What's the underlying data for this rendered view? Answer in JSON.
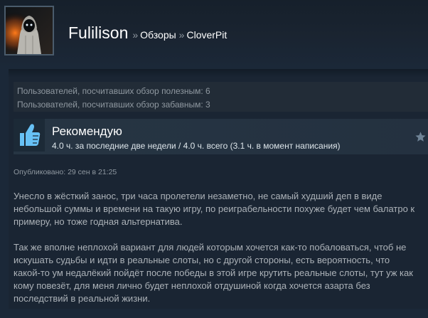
{
  "header": {
    "persona_name": "Fulilison",
    "breadcrumb_sep": "»",
    "breadcrumb_reviews": "Обзоры",
    "breadcrumb_game": "CloverPit"
  },
  "ratings": {
    "helpful": "Пользователей, посчитавших обзор полезным: 6",
    "funny": "Пользователей, посчитавших обзор забавным: 3"
  },
  "review": {
    "verdict": "Рекомендую",
    "hours": "4.0 ч. за последние две недели / 4.0 ч. всего (3.1 ч. в момент написания)",
    "posted": "Опубликовано: 29 сен в 21:25",
    "paragraphs": [
      "Унесло в жёсткий занос, три часа пролетели незаметно, не самый худший деп в виде небольшой суммы и времени на такую игру, по реиграбельности похуже будет чем балатро к примеру, но тоже годная альтернатива.",
      "Так же вполне неплохой вариант для людей которым хочется как-то побаловаться, чтоб не искушать судьбы и идти в реальные слоты, но с другой стороны, есть вероятность, что какой-то ум недалёкий пойдёт после победы в этой игре крутить реальные слоты, тут уж как кому повезёт, для меня лично будет неплохой отдушиной когда хочется азарта без последствий в реальной жизни."
    ]
  },
  "colors": {
    "background": "#1b2838",
    "thumb": "#67c1f5",
    "name": "#ffffff",
    "muted": "#8f98a0",
    "body_text": "#acb2b8"
  },
  "icons": {
    "verdict": "thumbs-up-icon",
    "award": "star-icon"
  }
}
